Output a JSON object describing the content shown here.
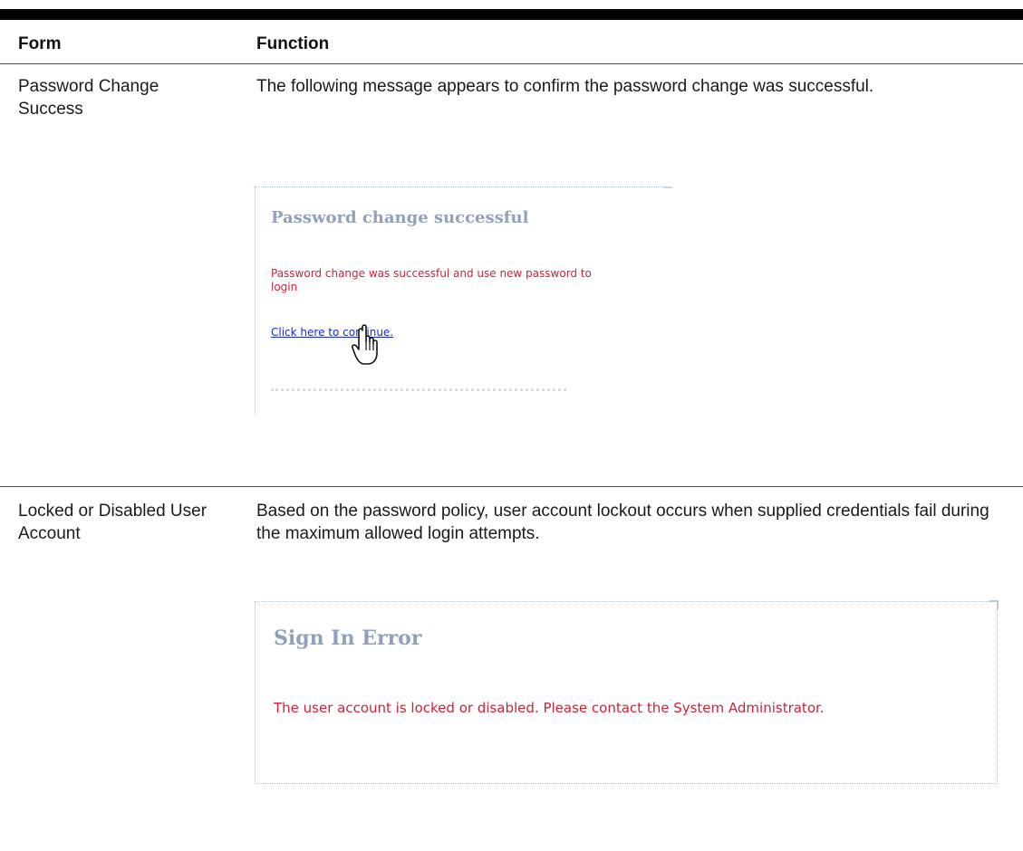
{
  "table": {
    "headers": {
      "form": "Form",
      "function": "Function"
    },
    "rows": [
      {
        "form": "Password Change Success",
        "function": "The following message appears to confirm the password change was successful.",
        "screenshot": {
          "title": "Password change successful",
          "message": "Password change was successful and use new password to login",
          "link": "Click here to continue."
        }
      },
      {
        "form": "Locked or Disabled User Account",
        "function": "Based on the password policy, user account lockout occurs when supplied credentials fail during the maximum allowed login attempts.",
        "screenshot": {
          "title": "Sign In Error",
          "message": "The user account is locked or disabled. Please contact the System Administrator."
        }
      }
    ]
  },
  "colors": {
    "screenshot_title": "#8fa1bd",
    "error_message": "#d0203a",
    "link": "#1a2ad4",
    "table_rule": "#000000"
  },
  "icons": {
    "cursor": "hand-pointer-icon"
  }
}
